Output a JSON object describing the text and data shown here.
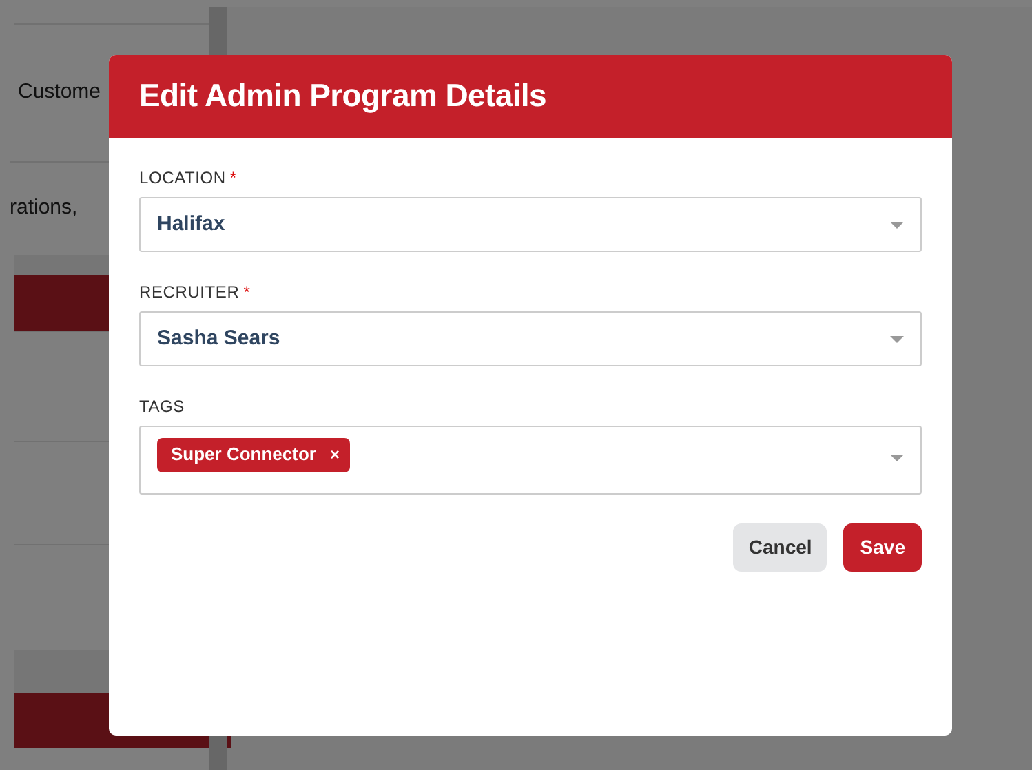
{
  "background": {
    "rows": [
      {
        "text": "Custome"
      },
      {
        "text": "rations,"
      }
    ]
  },
  "modal": {
    "title": "Edit Admin Program Details",
    "fields": [
      {
        "kind": "select",
        "label": "LOCATION",
        "required_mark": "*",
        "value": "Halifax"
      },
      {
        "kind": "select",
        "label": "RECRUITER",
        "required_mark": "*",
        "value": "Sasha Sears"
      },
      {
        "kind": "tags",
        "label": "TAGS",
        "tags": [
          {
            "text": "Super Connector",
            "remove": "×"
          }
        ]
      }
    ],
    "buttons": [
      {
        "kind": "secondary",
        "label": "Cancel"
      },
      {
        "kind": "primary",
        "label": "Save"
      }
    ]
  }
}
